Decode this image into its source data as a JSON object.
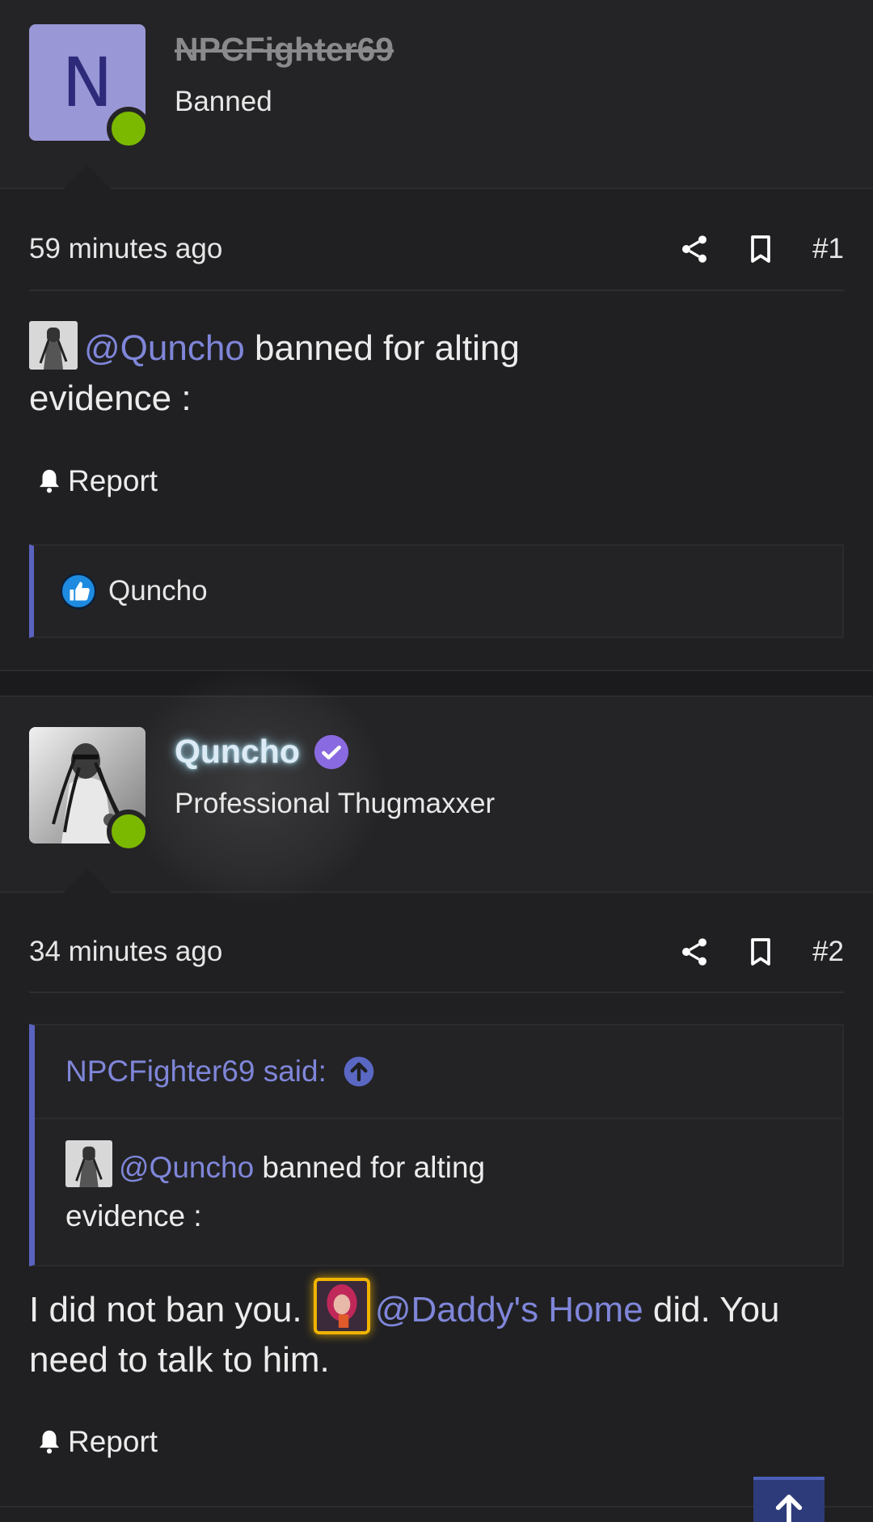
{
  "posts": [
    {
      "avatar_letter": "N",
      "username": "NPCFighter69",
      "user_title": "Banned",
      "time": "59 minutes ago",
      "number": "#1",
      "body_mention": "@Quncho",
      "body_text_1": " banned for alting",
      "body_text_2": "evidence :",
      "report_label": "Report",
      "reaction_user": "Quncho"
    },
    {
      "username": "Quncho",
      "user_title": "Professional Thugmaxxer",
      "time": "34 minutes ago",
      "number": "#2",
      "quote_author": "NPCFighter69 said:",
      "quote_mention": "@Quncho",
      "quote_text_1": " banned for alting",
      "quote_text_2": "evidence :",
      "body_text_1": "I did not ban you. ",
      "body_mention": "@Daddy's Home",
      "body_text_2": " did. You",
      "body_text_3": "need to talk to him.",
      "report_label": "Report"
    }
  ],
  "colors": {
    "accent": "#7f86d9",
    "online": "#7bb800",
    "verified": "#8a6ae0",
    "avatar_bg": "#9a97d6"
  }
}
